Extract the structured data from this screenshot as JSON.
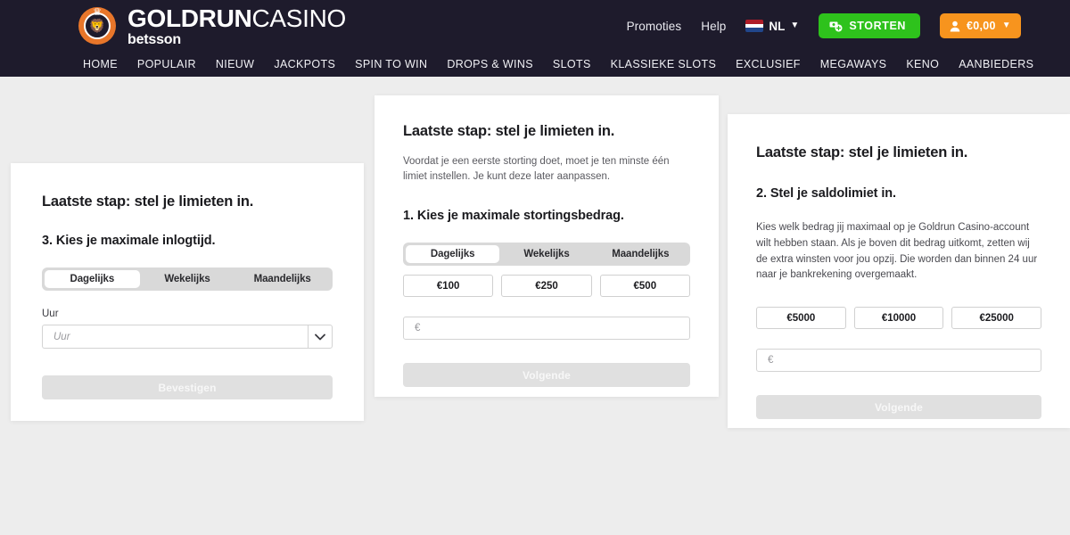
{
  "header": {
    "logo": {
      "mark_icon": "lion-crown-icon",
      "name_bold": "GOLDRUN",
      "name_light": "CASINO",
      "subtitle": "betsson",
      "circle_color": "#e8762a"
    },
    "links": [
      {
        "label": "Promoties",
        "name": "promoties-link"
      },
      {
        "label": "Help",
        "name": "help-link"
      }
    ],
    "language": {
      "label": "NL",
      "flag_icon": "netherlands-flag-icon",
      "caret_icon": "chevron-down-icon"
    },
    "deposit_button": {
      "label": "STORTEN",
      "icon": "money-plus-icon",
      "color": "#2ec21c"
    },
    "balance_button": {
      "label": "€0,00",
      "icon": "user-icon",
      "caret_icon": "chevron-down-icon",
      "color": "#f7941e"
    },
    "nav": [
      "HOME",
      "POPULAIR",
      "NIEUW",
      "JACKPOTS",
      "SPIN TO WIN",
      "DROPS & WINS",
      "SLOTS",
      "KLASSIEKE SLOTS",
      "EXCLUSIEF",
      "MEGAWAYS",
      "KENO",
      "AANBIEDERS"
    ]
  },
  "cards": {
    "left": {
      "title": "Laatste stap: stel je limieten in.",
      "step": "3. Kies je maximale inlogtijd.",
      "tabs": [
        "Dagelijks",
        "Wekelijks",
        "Maandelijks"
      ],
      "active_tab": "Dagelijks",
      "select_label": "Uur",
      "select_placeholder": "Uur",
      "submit_label": "Bevestigen"
    },
    "middle": {
      "title": "Laatste stap: stel je limieten in.",
      "intro": "Voordat je een eerste storting doet, moet je ten minste één limiet instellen. Je kunt deze later aanpassen.",
      "step": "1. Kies je maximale stortingsbedrag.",
      "tabs": [
        "Dagelijks",
        "Wekelijks",
        "Maandelijks"
      ],
      "active_tab": "Dagelijks",
      "presets": [
        "€100",
        "€250",
        "€500"
      ],
      "amount_placeholder": "€",
      "submit_label": "Volgende"
    },
    "right": {
      "title": "Laatste stap: stel je limieten in.",
      "step": "2. Stel je saldolimiet in.",
      "body": "Kies welk bedrag jij maximaal op je Goldrun Casino-account wilt hebben staan. Als je boven dit bedrag uitkomt, zetten wij de extra winsten voor jou opzij. Die worden dan binnen 24 uur naar je bankrekening overgemaakt.",
      "presets": [
        "€5000",
        "€10000",
        "€25000"
      ],
      "amount_placeholder": "€",
      "submit_label": "Volgende"
    }
  }
}
